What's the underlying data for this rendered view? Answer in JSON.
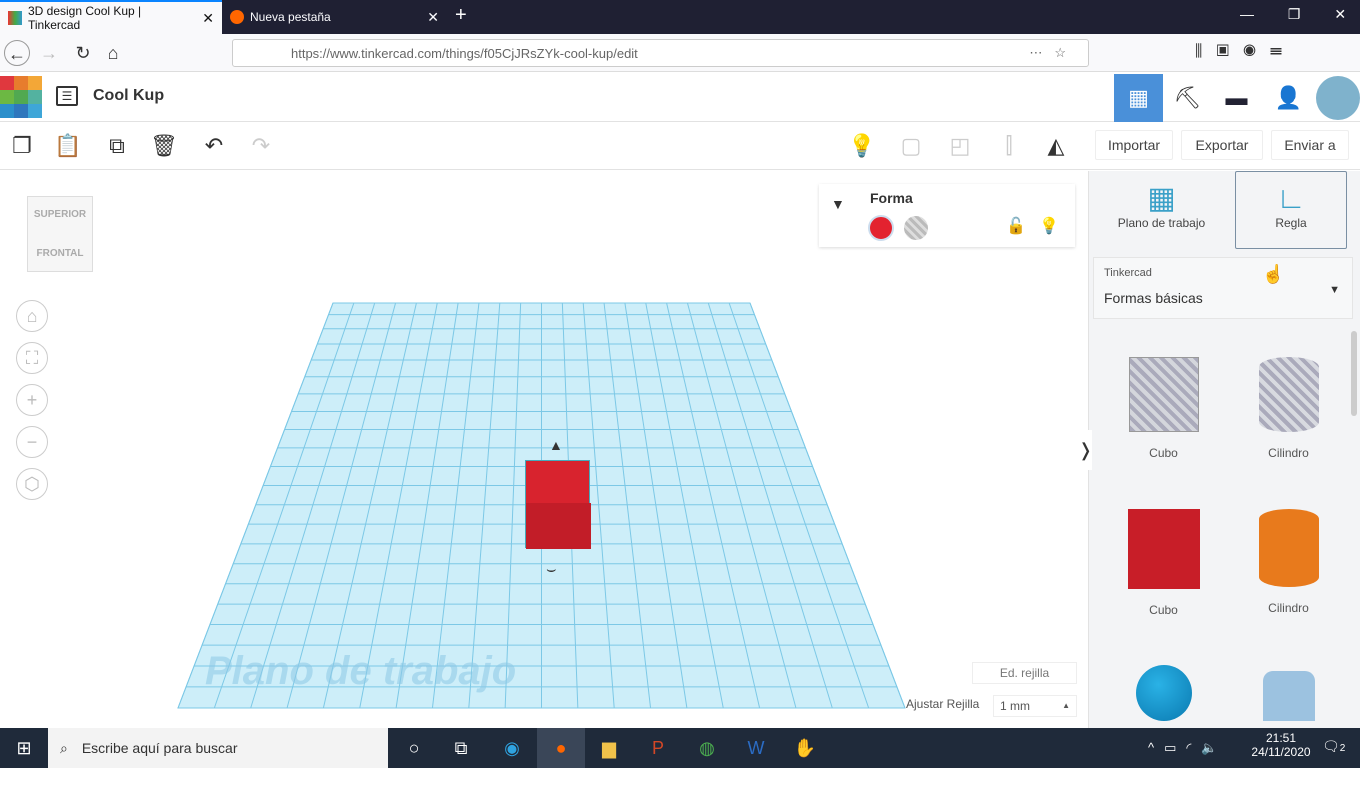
{
  "browser": {
    "tabs": [
      {
        "title": "3D design Cool Kup | Tinkercad",
        "active": true
      },
      {
        "title": "Nueva pestaña",
        "active": false
      }
    ],
    "url": "https://www.tinkercad.com/things/f05CjJRsZYk-cool-kup/edit"
  },
  "app": {
    "logo_letters": [
      "T",
      "I",
      "N",
      "K",
      "E",
      "R",
      "C",
      "A",
      "D"
    ],
    "title": "Cool Kup",
    "toolbar": {
      "import": "Importar",
      "export": "Exportar",
      "send": "Enviar a"
    },
    "viewcube": {
      "top": "SUPERIOR",
      "front": "FRONTAL"
    },
    "inspector": {
      "title": "Forma",
      "solid_color": "#e3222f"
    },
    "workplane_label": "Plano de trabajo",
    "grid": {
      "edit": "Ed. rejilla",
      "snap_label": "Ajustar Rejilla",
      "snap_value": "1 mm"
    },
    "panel": {
      "tools": [
        {
          "label": "Plano de trabajo",
          "icon": "workplane-icon"
        },
        {
          "label": "Regla",
          "icon": "ruler-icon"
        }
      ],
      "library_source": "Tinkercad",
      "library": "Formas básicas",
      "shapes": [
        {
          "label": "Cubo",
          "color": "#b8bcc4"
        },
        {
          "label": "Cilindro",
          "color": "#c4c8ce"
        },
        {
          "label": "Cubo",
          "color": "#d0202a"
        },
        {
          "label": "Cilindro",
          "color": "#e87a1c"
        }
      ]
    }
  },
  "taskbar": {
    "search_placeholder": "Escribe aquí para buscar",
    "time": "21:51",
    "date": "24/11/2020",
    "notifications": "2"
  },
  "colors": {
    "accent": "#4a90d9",
    "grid": "#8fd3ee"
  }
}
